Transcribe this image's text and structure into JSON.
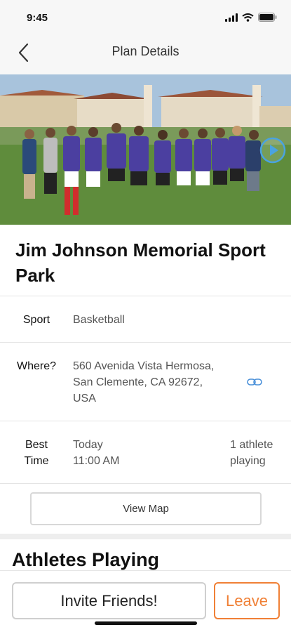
{
  "status_bar": {
    "time": "9:45",
    "icons": [
      "signal-icon",
      "wifi-icon",
      "battery-icon"
    ]
  },
  "nav": {
    "title": "Plan Details",
    "back_icon": "chevron-left-icon"
  },
  "hero": {
    "play_icon": "play-circle-icon"
  },
  "place": {
    "title": "Jim Johnson Memorial Sport Park"
  },
  "details": {
    "sport_label": "Sport",
    "sport_value": "Basketball",
    "where_label": "Where?",
    "where_line1": "560 Avenida Vista Hermosa,",
    "where_line2": "San Clemente, CA 92672,",
    "where_line3": "USA",
    "link_icon": "link-icon",
    "time_label_line1": "Best",
    "time_label_line2": "Time",
    "time_line1": "Today",
    "time_line2": "11:00 AM",
    "playing_line1": "1 athlete",
    "playing_line2": "playing"
  },
  "view_map_label": "View Map",
  "athletes_heading": "Athletes Playing",
  "actions": {
    "invite_label": "Invite Friends!",
    "leave_label": "Leave"
  },
  "colors": {
    "accent": "#f08036",
    "link": "#4a90d9"
  }
}
